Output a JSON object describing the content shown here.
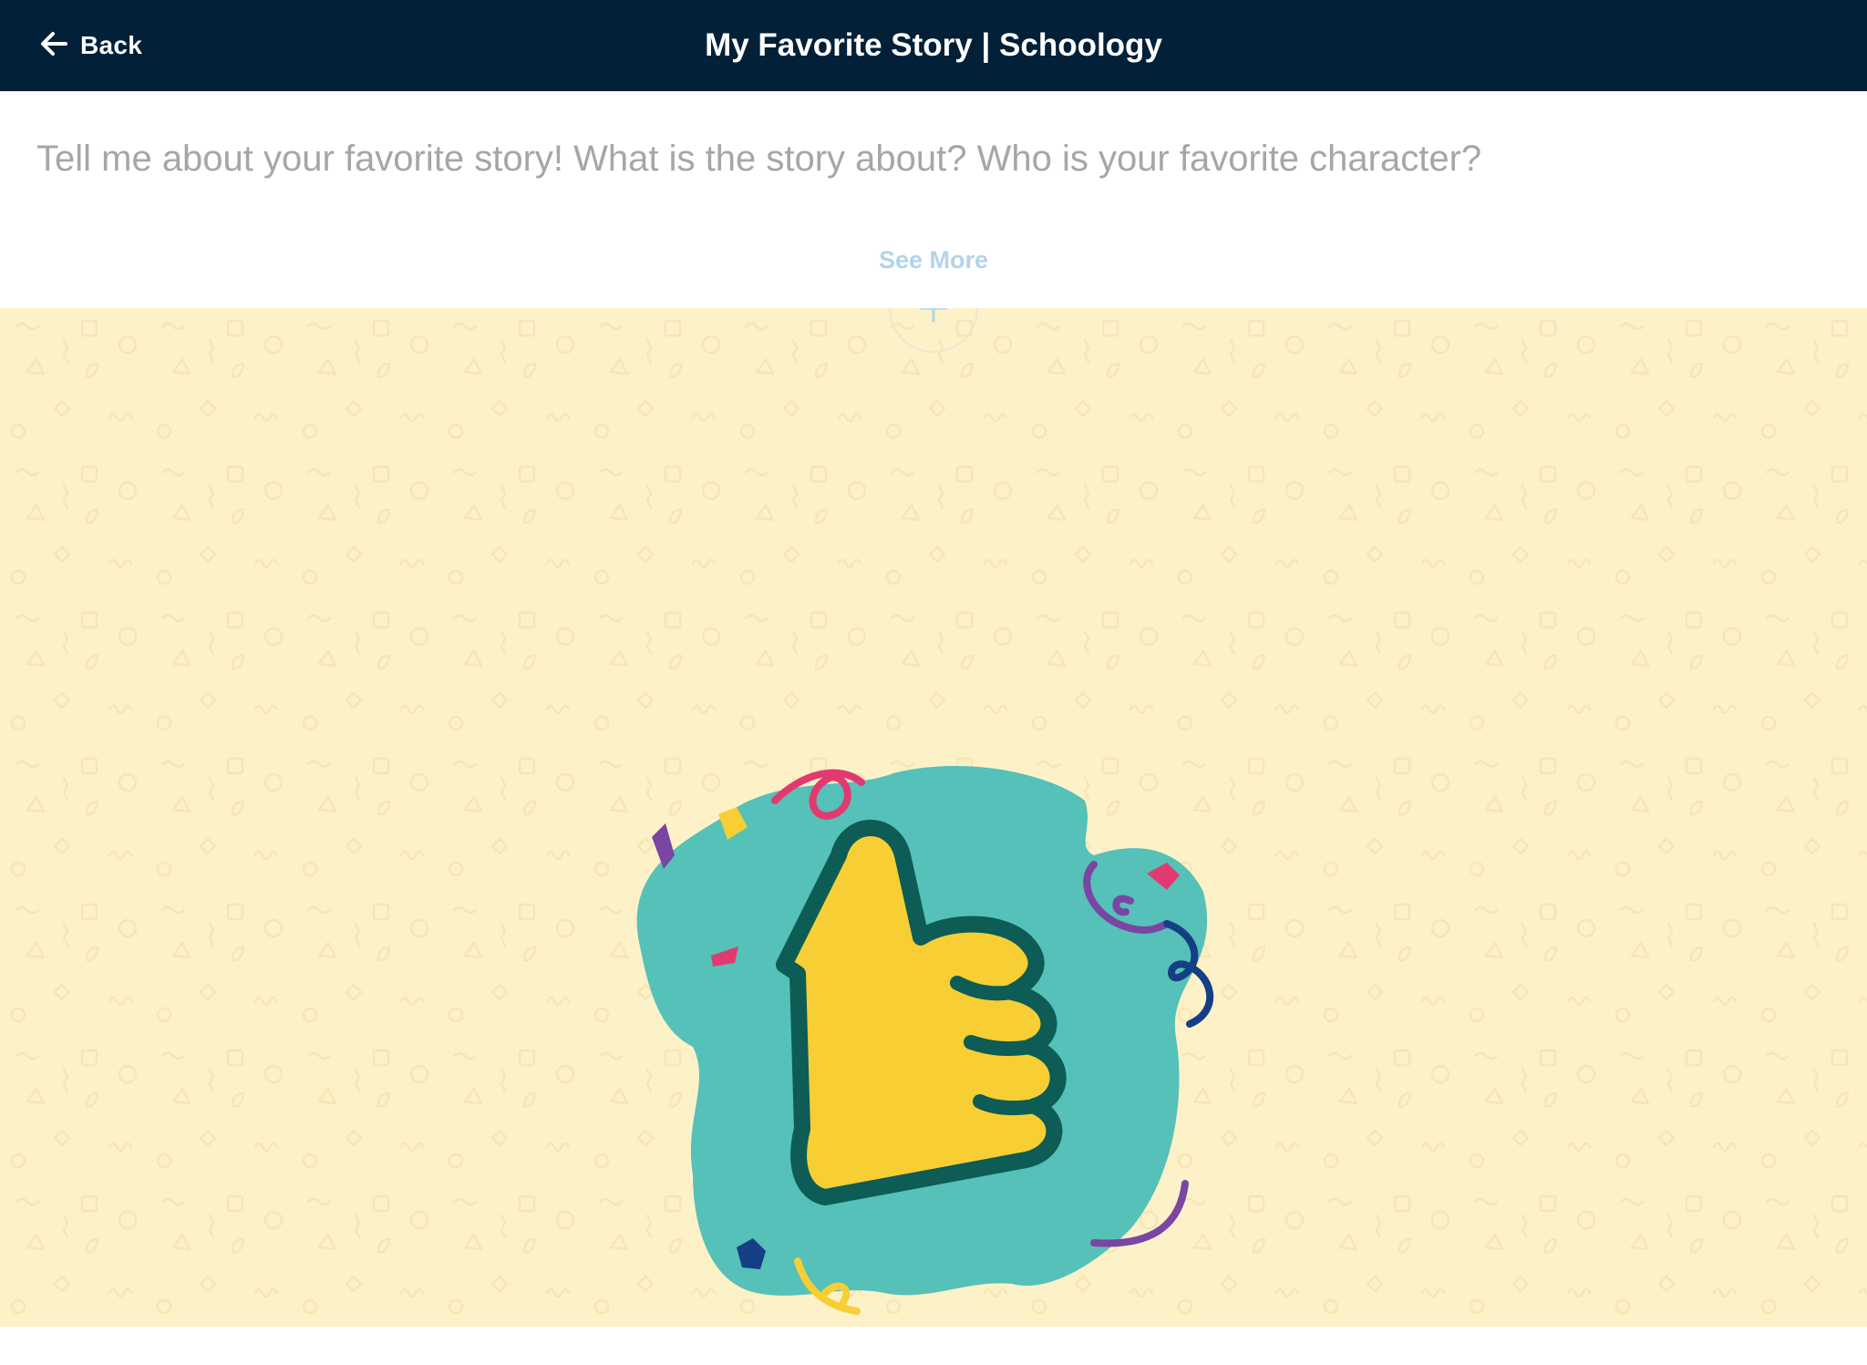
{
  "header": {
    "back_label": "Back",
    "title": "My Favorite Story | Schoology",
    "background": "#022038"
  },
  "prompt": {
    "text": "Tell me about your favorite story! What is the story about? Who is your favorite character?",
    "see_more_label": "See More",
    "text_color": "#a6a6a6",
    "link_color": "#b3d4ea"
  },
  "canvas": {
    "background": "#fdf1c8",
    "illustration": "thumbs-up-celebration",
    "icons": {
      "back": "arrow-left-icon",
      "expand": "plus-icon"
    }
  },
  "colors": {
    "teal": "#55c1b8",
    "yellow": "#f7ce33",
    "dark_green": "#0d5c55",
    "pink": "#e13a71",
    "purple": "#7a45a3",
    "navy": "#143f85"
  }
}
